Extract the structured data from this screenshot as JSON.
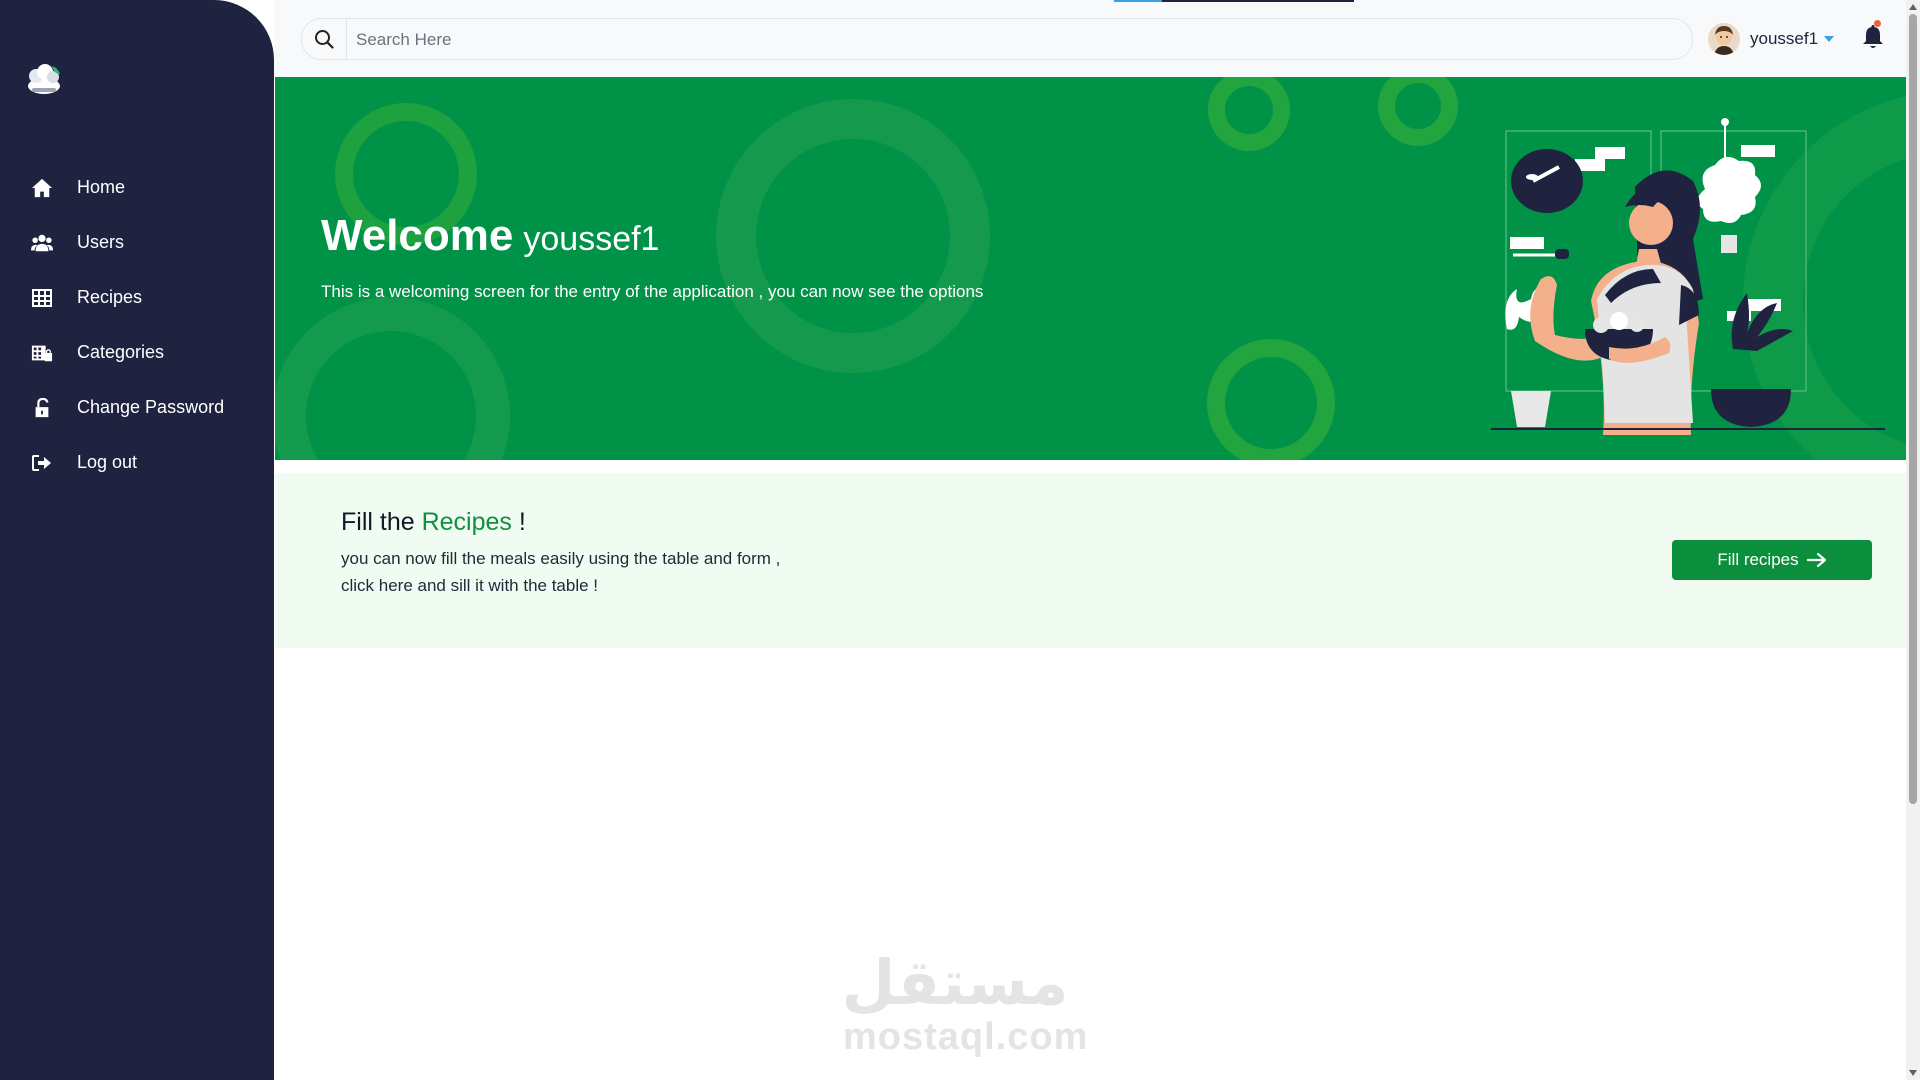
{
  "app": {
    "logo_icon": "chef-hat-icon"
  },
  "sidebar": {
    "items": [
      {
        "label": "Home",
        "icon": "home-icon"
      },
      {
        "label": "Users",
        "icon": "users-icon"
      },
      {
        "label": "Recipes",
        "icon": "table-grid-icon"
      },
      {
        "label": "Categories",
        "icon": "categories-icon"
      },
      {
        "label": "Change Password",
        "icon": "lock-open-icon"
      },
      {
        "label": "Log out",
        "icon": "logout-icon"
      }
    ]
  },
  "header": {
    "search": {
      "placeholder": "Search Here",
      "value": ""
    },
    "user": {
      "name": "youssef1"
    }
  },
  "banner": {
    "welcome": "Welcome",
    "username": "youssef1",
    "subtitle": "This is a welcoming screen for the entry of the application , you can now see the options"
  },
  "recipes_card": {
    "title_prefix": "Fill the",
    "title_highlight": "Recipes",
    "title_suffix": "!",
    "line1": "you can now fill the meals easily using the table and form ,",
    "line2": "click here and sill it with the table !",
    "button_label": "Fill recipes"
  },
  "watermark": {
    "arabic": "مستقل",
    "latin": "mostaql.com"
  },
  "colors": {
    "sidebar": "#1f2340",
    "banner": "#009247",
    "accent_green": "#11913f",
    "card_bg": "#f0fbf2",
    "notification_dot": "#e8643c"
  }
}
